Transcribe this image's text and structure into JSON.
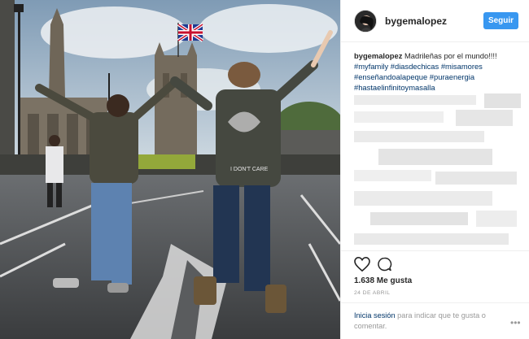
{
  "post": {
    "author": {
      "username": "bygemalopez",
      "avatar_icon": "profile-avatar"
    },
    "follow_button_label": "Seguir",
    "caption": {
      "username": "bygemalopez",
      "text": "Madrileñas por el mundo!!!!",
      "hashtag_lines": [
        "#myfamily #diasdechicas #misamores",
        "#enseñandoalapeque #puraenergia",
        "#hastaelinfinitoymasalla"
      ]
    },
    "actions": {
      "like_icon": "heart-icon",
      "comment_icon": "comment-icon"
    },
    "likes": "1.638 Me gusta",
    "date": "24 DE ABRIL",
    "footer": {
      "login_link": "Inicia sesión",
      "login_text": " para indicar que te gusta o comentar.",
      "more_icon": "more-options-icon",
      "more_glyph": "•••"
    },
    "photo": {
      "shirt_text": "I DON'T CARE",
      "accent_colors": {
        "flag_blue": "#1f3a93",
        "flag_red": "#c8102e",
        "sky": "#b7c7d6"
      }
    }
  }
}
